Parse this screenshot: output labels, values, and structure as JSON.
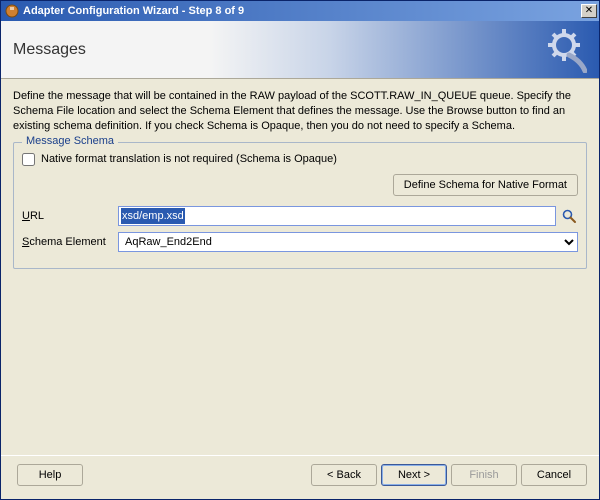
{
  "window": {
    "title": "Adapter Configuration Wizard - Step 8 of 9"
  },
  "banner": {
    "heading": "Messages"
  },
  "description": "Define the message that will be contained in the RAW payload of the SCOTT.RAW_IN_QUEUE queue.  Specify the Schema File location and select the Schema Element that defines the message. Use the Browse button to find an existing schema definition. If you check Schema is Opaque, then you do not need to specify a Schema.",
  "fieldset": {
    "legend": "Message Schema",
    "opaque_checkbox_label": "Native format translation is not required (Schema is Opaque)",
    "opaque_checked": false,
    "define_schema_button": "Define Schema for Native Format",
    "url_label_prefix": "U",
    "url_label_rest": "RL",
    "url_value": "xsd/emp.xsd",
    "schema_element_label_prefix": "S",
    "schema_element_label_rest": "chema Element",
    "schema_element_value": "AqRaw_End2End"
  },
  "footer": {
    "help": "Help",
    "back": "< Back",
    "next": "Next >",
    "finish": "Finish",
    "cancel": "Cancel"
  }
}
